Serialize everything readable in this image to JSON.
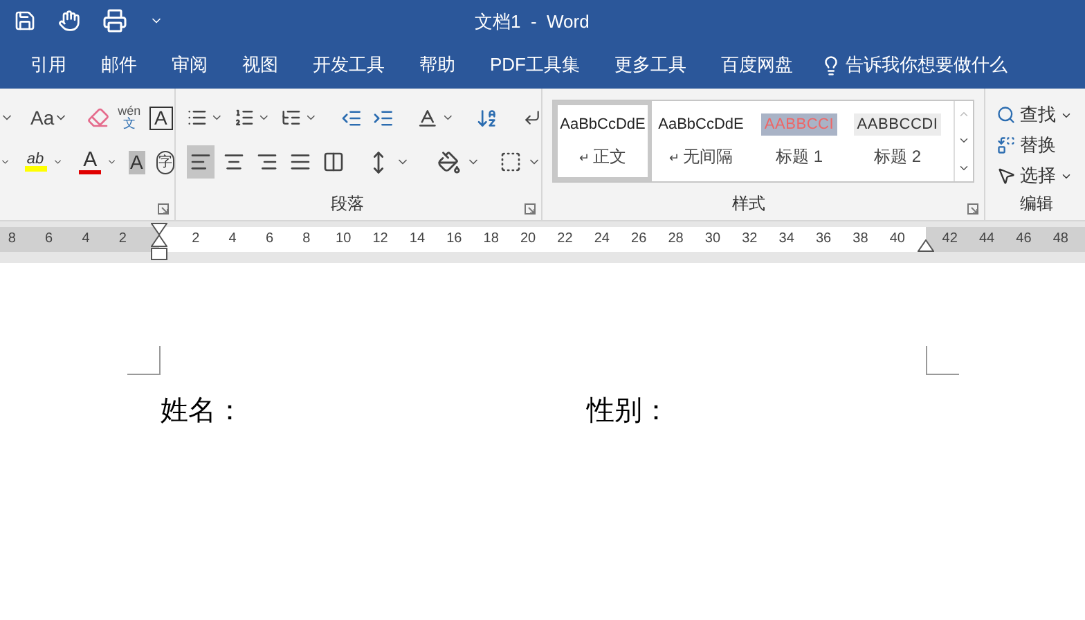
{
  "window": {
    "title": "文档1  -  Word"
  },
  "tabs": [
    {
      "label": "引用",
      "selected": false
    },
    {
      "label": "邮件",
      "selected": false
    },
    {
      "label": "审阅",
      "selected": false
    },
    {
      "label": "视图",
      "selected": false
    },
    {
      "label": "开发工具",
      "selected": false
    },
    {
      "label": "帮助",
      "selected": false
    },
    {
      "label": "PDF工具集",
      "selected": false
    },
    {
      "label": "更多工具",
      "selected": false
    },
    {
      "label": "百度网盘",
      "selected": false
    }
  ],
  "tell_me": {
    "placeholder": "告诉我你想要做什么"
  },
  "font_group": {
    "change_case": "Aa",
    "phonetic_top": "wén",
    "phonetic_bottom": "文",
    "char_border": "A",
    "highlight": "ab",
    "font_color": "A",
    "char_shading": "A",
    "enclose": "字"
  },
  "paragraph_group": {
    "label": "段落",
    "alignment": [
      {
        "kind": "left",
        "selected": true
      },
      {
        "kind": "center",
        "selected": false
      },
      {
        "kind": "right",
        "selected": false
      },
      {
        "kind": "justify",
        "selected": false
      },
      {
        "kind": "distributed",
        "selected": false
      }
    ]
  },
  "styles_group": {
    "label": "样式",
    "styles": [
      {
        "kind": "body",
        "preview": "AaBbCcDdE",
        "mark": "↵",
        "name": "正文",
        "selected": true
      },
      {
        "kind": "body",
        "preview": "AaBbCcDdE",
        "mark": "↵",
        "name": "无间隔",
        "selected": false
      },
      {
        "kind": "heading1",
        "preview": "AABBCCI",
        "name": "标题 1",
        "selected": false
      },
      {
        "kind": "heading2",
        "preview": "AABBCCDI",
        "name": "标题 2",
        "selected": false
      }
    ]
  },
  "editing_group": {
    "label": "编辑",
    "find": "查找",
    "replace": "替换",
    "select": "选择"
  },
  "ruler": {
    "left_numbers": [
      "8",
      "6",
      "4",
      "2"
    ],
    "numbers": [
      "2",
      "4",
      "6",
      "8",
      "10",
      "12",
      "14",
      "16",
      "18",
      "20",
      "22",
      "24",
      "26",
      "28",
      "30",
      "32",
      "34",
      "36",
      "38",
      "40"
    ],
    "right_numbers": [
      "42",
      "44",
      "46",
      "48"
    ]
  },
  "document": {
    "fields": [
      "姓名：",
      "性别："
    ]
  }
}
